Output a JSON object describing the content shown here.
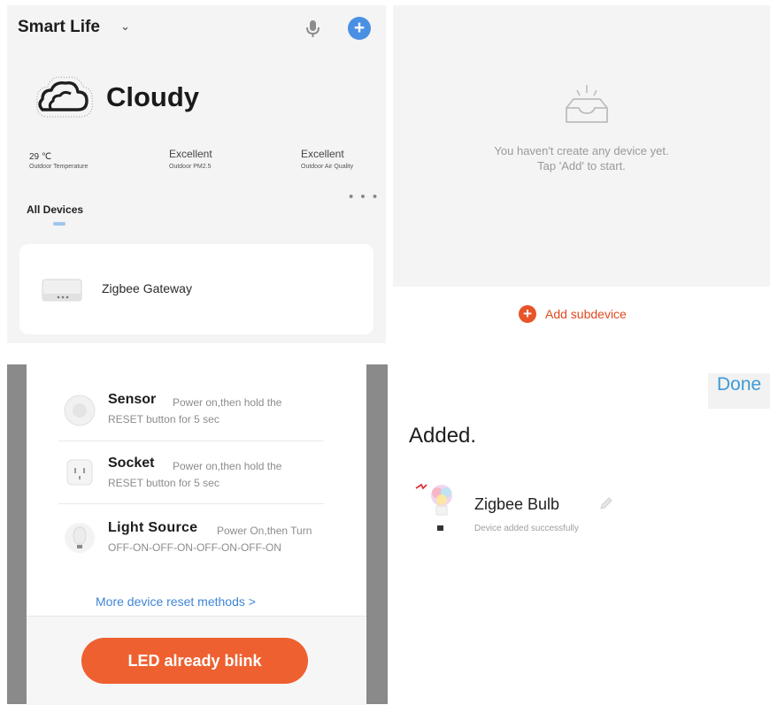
{
  "home": {
    "app_title": "Smart Life",
    "weather": "Cloudy",
    "stats": [
      {
        "value": "29 ℃",
        "label": "Outdoor Temperature"
      },
      {
        "value": "Excellent",
        "label": "Outdoor PM2.5"
      },
      {
        "value": "Excellent",
        "label": "Outdoor Air Quality"
      }
    ],
    "more_dots": "• • •",
    "tab_all": "All Devices",
    "devices": [
      {
        "name": "Zigbee Gateway"
      }
    ],
    "icons": {
      "dropdown": "chevron-down-icon",
      "mic": "microphone-icon",
      "add": "plus-icon",
      "weather": "cloud-icon",
      "device": "gateway-icon"
    },
    "accent": "#4a90e2"
  },
  "gateway": {
    "empty_line1": "You haven't create any device yet.",
    "empty_line2": "Tap 'Add' to start.",
    "add_subdevice": "Add subdevice",
    "accent": "#e8542a",
    "icons": {
      "empty": "empty-box-icon",
      "add": "plus-icon"
    }
  },
  "reset": {
    "items": [
      {
        "name": "Sensor",
        "desc1": "Power on,then hold the",
        "desc2": "RESET button for 5 sec",
        "icon": "sensor-icon"
      },
      {
        "name": "Socket",
        "desc1": "Power on,then hold the",
        "desc2": "RESET button for 5 sec",
        "icon": "socket-icon"
      },
      {
        "name": "Light Source",
        "desc1": "Power On,then Turn",
        "desc2": "OFF-ON-OFF-ON-OFF-ON-OFF-ON",
        "icon": "bulb-icon"
      }
    ],
    "more_link": "More device reset methods >",
    "led_button": "LED already blink",
    "accent": "#ee6030"
  },
  "added": {
    "done": "Done",
    "title": "Added.",
    "device_name": "Zigbee Bulb",
    "status": "Device added successfully",
    "icons": {
      "device": "color-bulb-icon",
      "edit": "pencil-icon"
    },
    "accent": "#3e9ad8"
  }
}
